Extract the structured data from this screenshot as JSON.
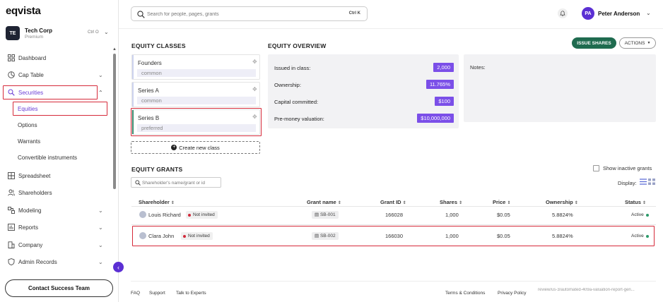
{
  "app": {
    "logo": "eqvista"
  },
  "org": {
    "initials": "TE",
    "name": "Tech Corp",
    "plan": "Premium",
    "shortcut": "Ctrl O"
  },
  "search": {
    "placeholder": "Search for people, pages, grants",
    "shortcut": "Ctrl K"
  },
  "user": {
    "initials": "PA",
    "name": "Peter Anderson"
  },
  "nav": {
    "dashboard": "Dashboard",
    "cap_table": "Cap Table",
    "securities": "Securities",
    "sub": {
      "equities": "Equities",
      "options": "Options",
      "warrants": "Warrants",
      "convertible": "Convertible instruments"
    },
    "spreadsheet": "Spreadsheet",
    "shareholders": "Shareholders",
    "modeling": "Modeling",
    "reports": "Reports",
    "company": "Company",
    "admin_records": "Admin Records",
    "contact": "Contact Success Team"
  },
  "equity_classes": {
    "title": "EQUITY CLASSES",
    "items": [
      {
        "name": "Founders",
        "type": "common"
      },
      {
        "name": "Series A",
        "type": "common"
      },
      {
        "name": "Series B",
        "type": "preferred"
      }
    ],
    "create_label": "Create new class"
  },
  "overview": {
    "title": "EQUITY OVERVIEW",
    "rows": [
      {
        "label": "Issued in class:",
        "value": "2,000"
      },
      {
        "label": "Ownership:",
        "value": "11.765%"
      },
      {
        "label": "Capital committed:",
        "value": "$100"
      },
      {
        "label": "Pre-money valuation:",
        "value": "$10,000,000"
      }
    ],
    "notes_label": "Notes:"
  },
  "buttons": {
    "issue": "ISSUE SHARES",
    "actions": "ACTIONS"
  },
  "grants": {
    "title": "EQUITY GRANTS",
    "show_inactive": "Show inactive grants",
    "search_placeholder": "Shareholder's name/grant or id",
    "display_label": "Display:",
    "columns": {
      "shareholder": "Shareholder",
      "grant_name": "Grant name",
      "grant_id": "Grant ID",
      "shares": "Shares",
      "price": "Price",
      "ownership": "Ownership",
      "status": "Status"
    },
    "rows": [
      {
        "shareholder": "Louis Richard",
        "invite": "Not invited",
        "grant_name": "SB-001",
        "grant_id": "166028",
        "shares": "1,000",
        "price": "$0.05",
        "ownership": "5.8824%",
        "status": "Active"
      },
      {
        "shareholder": "Clara John",
        "invite": "Not invited",
        "grant_name": "SB-002",
        "grant_id": "166030",
        "shares": "1,000",
        "price": "$0.05",
        "ownership": "5.8824%",
        "status": "Active"
      }
    ]
  },
  "footer": {
    "faq": "FAQ",
    "support": "Support",
    "experts": "Talk to Experts",
    "terms": "Terms & Conditions",
    "privacy": "Privacy Policy",
    "url": "review/us-3/automated-409a-valuation-report-gen..."
  },
  "colors": {
    "accent": "#6a3dd6",
    "brand_green": "#1f6b4f",
    "highlight_red": "#d62a3a"
  }
}
